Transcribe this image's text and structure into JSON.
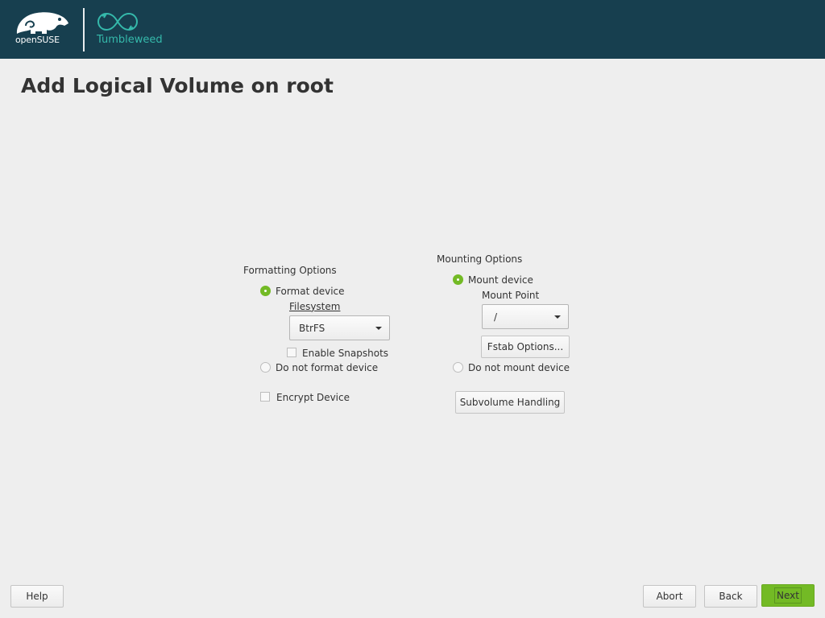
{
  "header": {
    "brand": "openSUSE",
    "product": "Tumbleweed"
  },
  "page": {
    "title": "Add Logical Volume on root"
  },
  "formatting": {
    "section_label": "Formatting Options",
    "format_device_label": "Format device",
    "format_device_selected": true,
    "filesystem_label": "Filesystem",
    "filesystem_value": "BtrFS",
    "enable_snapshots_label": "Enable Snapshots",
    "enable_snapshots_checked": false,
    "do_not_format_label": "Do not format device",
    "do_not_format_selected": false,
    "encrypt_device_label": "Encrypt Device",
    "encrypt_device_checked": false
  },
  "mounting": {
    "section_label": "Mounting Options",
    "mount_device_label": "Mount device",
    "mount_device_selected": true,
    "mount_point_label": "Mount Point",
    "mount_point_value": "/",
    "fstab_options_label": "Fstab Options...",
    "do_not_mount_label": "Do not mount device",
    "do_not_mount_selected": false,
    "subvolume_handling_label": "Subvolume Handling"
  },
  "footer": {
    "help_label": "Help",
    "abort_label": "Abort",
    "back_label": "Back",
    "next_label": "Next"
  },
  "colors": {
    "header_bg": "#173f4f",
    "accent_green": "#73ba25",
    "tumbleweed_teal": "#35b9ab"
  },
  "icons": {
    "brand_logo": "opensuse-chameleon-icon",
    "product_logo": "tumbleweed-infinity-icon"
  }
}
